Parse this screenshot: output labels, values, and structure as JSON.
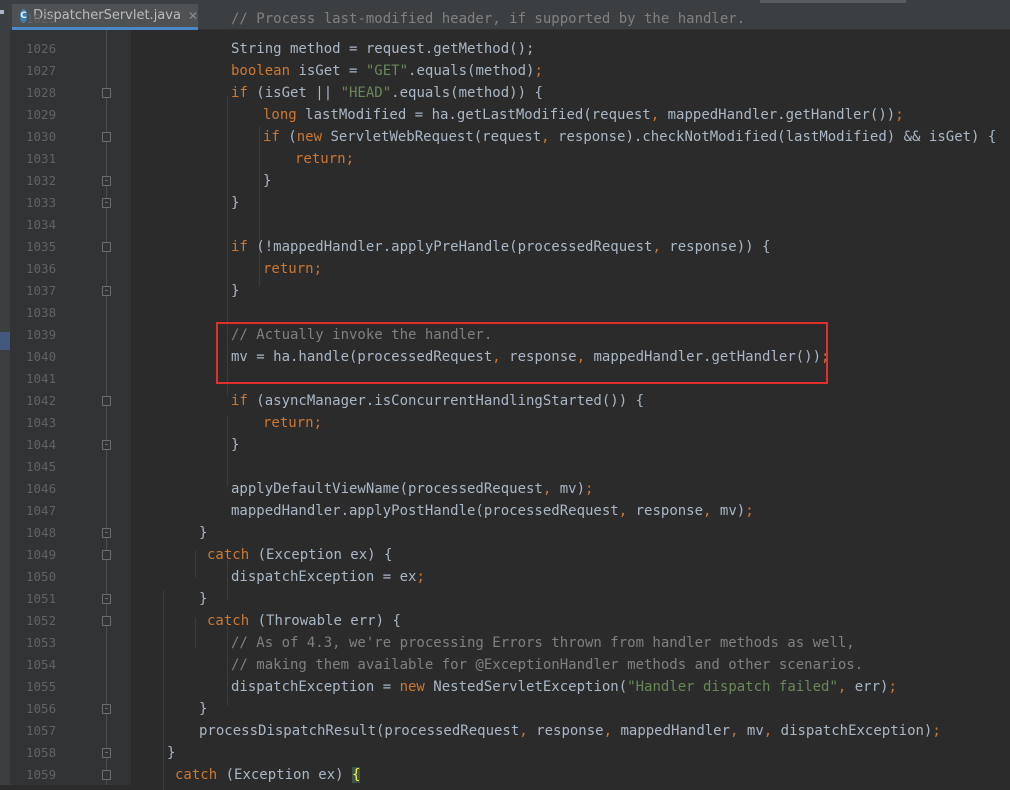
{
  "tab": {
    "icon_letter": "C",
    "filename": "DispatcherServlet.java",
    "close_glyph": "✕"
  },
  "code_lines": [
    {
      "num": "1026",
      "indent": 0,
      "tokens": [
        [
          "",
          "String method = request.getMethod();"
        ]
      ]
    },
    {
      "num": "1027",
      "tokens": [
        [
          "kw",
          "boolean"
        ],
        [
          "",
          " isGet = "
        ],
        [
          "str",
          "\"GET\""
        ],
        [
          "",
          ".equals(method)"
        ],
        [
          "kw",
          ";"
        ]
      ]
    },
    {
      "num": "1028",
      "tokens": [
        [
          "kw",
          "if"
        ],
        [
          "",
          " (isGet || "
        ],
        [
          "str",
          "\"HEAD\""
        ],
        [
          "",
          ".equals(method)) {"
        ]
      ]
    },
    {
      "num": "1029",
      "tokens": [
        [
          "kw",
          "long"
        ],
        [
          "",
          " lastModified = ha.getLastModified(request"
        ],
        [
          "kw",
          ","
        ],
        [
          "",
          " mappedHandler.getHandler())"
        ],
        [
          "kw",
          ";"
        ]
      ]
    },
    {
      "num": "1030",
      "tokens": [
        [
          "kw",
          "if"
        ],
        [
          "",
          " ("
        ],
        [
          "kw",
          "new"
        ],
        [
          "",
          " ServletWebRequest(request"
        ],
        [
          "kw",
          ","
        ],
        [
          "",
          " response).checkNotModified(lastModified) && isGet) {"
        ]
      ]
    },
    {
      "num": "1031",
      "tokens": [
        [
          "kw",
          "return;"
        ]
      ]
    },
    {
      "num": "1032",
      "tokens": [
        [
          "",
          "}"
        ]
      ]
    },
    {
      "num": "1033",
      "tokens": [
        [
          "",
          "}"
        ]
      ]
    },
    {
      "num": "1034",
      "tokens": []
    },
    {
      "num": "1035",
      "tokens": [
        [
          "kw",
          "if"
        ],
        [
          "",
          " (!mappedHandler.applyPreHandle(processedRequest"
        ],
        [
          "kw",
          ","
        ],
        [
          "",
          " response)) {"
        ]
      ]
    },
    {
      "num": "1036",
      "tokens": [
        [
          "kw",
          "return;"
        ]
      ]
    },
    {
      "num": "1037",
      "tokens": [
        [
          "",
          "}"
        ]
      ]
    },
    {
      "num": "1038",
      "tokens": []
    },
    {
      "num": "1039",
      "tokens": [
        [
          "cm",
          "// Actually invoke the handler."
        ]
      ]
    },
    {
      "num": "1040",
      "tokens": [
        [
          "",
          "mv = ha.handle(processedRequest"
        ],
        [
          "kw",
          ","
        ],
        [
          "",
          " response"
        ],
        [
          "kw",
          ","
        ],
        [
          "",
          " mappedHandler.getHandler())"
        ],
        [
          "kw",
          ";"
        ]
      ]
    },
    {
      "num": "1041",
      "tokens": []
    },
    {
      "num": "1042",
      "tokens": [
        [
          "kw",
          "if"
        ],
        [
          "",
          " (asyncManager.isConcurrentHandlingStarted()) {"
        ]
      ]
    },
    {
      "num": "1043",
      "tokens": [
        [
          "kw",
          "return;"
        ]
      ]
    },
    {
      "num": "1044",
      "tokens": [
        [
          "",
          "}"
        ]
      ]
    },
    {
      "num": "1045",
      "tokens": []
    },
    {
      "num": "1046",
      "tokens": [
        [
          "",
          "applyDefaultViewName(processedRequest"
        ],
        [
          "kw",
          ","
        ],
        [
          "",
          " mv)"
        ],
        [
          "kw",
          ";"
        ]
      ]
    },
    {
      "num": "1047",
      "tokens": [
        [
          "",
          "mappedHandler.applyPostHandle(processedRequest"
        ],
        [
          "kw",
          ","
        ],
        [
          "",
          " response"
        ],
        [
          "kw",
          ","
        ],
        [
          "",
          " mv)"
        ],
        [
          "kw",
          ";"
        ]
      ]
    },
    {
      "num": "1048",
      "tokens": [
        [
          "",
          "}"
        ]
      ]
    },
    {
      "num": "1049",
      "tokens": [
        [
          "kw",
          "catch"
        ],
        [
          "",
          " (Exception ex) {"
        ]
      ]
    },
    {
      "num": "1050",
      "tokens": [
        [
          "",
          "dispatchException = ex"
        ],
        [
          "kw",
          ";"
        ]
      ]
    },
    {
      "num": "1051",
      "tokens": [
        [
          "",
          "}"
        ]
      ]
    },
    {
      "num": "1052",
      "tokens": [
        [
          "kw",
          "catch"
        ],
        [
          "",
          " (Throwable err) {"
        ]
      ]
    },
    {
      "num": "1053",
      "tokens": [
        [
          "cm",
          "// As of 4.3, we're processing Errors thrown from handler methods as well,"
        ]
      ]
    },
    {
      "num": "1054",
      "tokens": [
        [
          "cm",
          "// making them available for @ExceptionHandler methods and other scenarios."
        ]
      ]
    },
    {
      "num": "1055",
      "tokens": [
        [
          "",
          "dispatchException = "
        ],
        [
          "kw",
          "new"
        ],
        [
          "",
          " NestedServletException("
        ],
        [
          "str",
          "\"Handler dispatch failed\""
        ],
        [
          "kw",
          ","
        ],
        [
          "",
          " err)"
        ],
        [
          "kw",
          ";"
        ]
      ]
    },
    {
      "num": "1056",
      "tokens": [
        [
          "",
          "}"
        ]
      ]
    },
    {
      "num": "1057",
      "tokens": [
        [
          "",
          "processDispatchResult(processedRequest"
        ],
        [
          "kw",
          ","
        ],
        [
          "",
          " response"
        ],
        [
          "kw",
          ","
        ],
        [
          "",
          " mappedHandler"
        ],
        [
          "kw",
          ","
        ],
        [
          "",
          " mv"
        ],
        [
          "kw",
          ","
        ],
        [
          "",
          " dispatchException)"
        ],
        [
          "kw",
          ";"
        ]
      ]
    },
    {
      "num": "1058",
      "tokens": [
        [
          "",
          "}"
        ]
      ]
    },
    {
      "num": "1059",
      "tokens": [
        [
          "kw",
          "catch"
        ],
        [
          "",
          " (Exception ex) "
        ],
        [
          "brace-hl",
          "{"
        ]
      ]
    }
  ],
  "partial_top_line": {
    "num": "1025",
    "text": "// Process last-modified header, if supported by the handler."
  },
  "highlight": {
    "color": "#e0302b",
    "lines": [
      "1039",
      "1040"
    ]
  },
  "colors": {
    "background": "#2b2b2b",
    "keyword": "#cc7832",
    "string": "#6a8759",
    "comment": "#808080",
    "text": "#a9b7c6",
    "line_number": "#606366"
  }
}
